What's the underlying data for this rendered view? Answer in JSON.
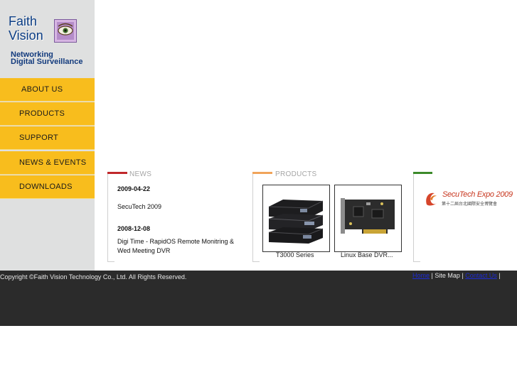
{
  "brand": {
    "logo_text_1": "Faith",
    "logo_text_2": "Vision",
    "tagline_1": "Networking",
    "tagline_2": "Digital Surveillance"
  },
  "nav": {
    "about": "ABOUT US",
    "products": "PRODUCTS",
    "support": "SUPPORT",
    "news": "NEWS & EVENTS",
    "downloads": "DOWNLOADS"
  },
  "news": {
    "title": "NEWS",
    "items": [
      {
        "date": "2009-04-22",
        "text": "SecuTech 2009"
      },
      {
        "date": "2008-12-08",
        "text": "Digi Time - RapidOS Remote Monitring & Wed Meeting DVR"
      }
    ]
  },
  "products": {
    "title": "PRODUCTS",
    "items": [
      {
        "caption": "T3000 Series"
      },
      {
        "caption": "Linux Base DVR..."
      }
    ]
  },
  "expo": {
    "logo_text": "SecuTech Expo 2009",
    "logo_subtext": "第十二屆台北國際安全博覽會"
  },
  "footer": {
    "copyright": "Copyright ©Faith Vision Technology Co., Ltd. All Rights Reserved.",
    "link_home": "Home",
    "link_sitemap": "Site Map",
    "link_contact": "Contact Us",
    "separator": "|"
  },
  "colors": {
    "nav_bg": "#f8bd1d",
    "sidebar_bg": "#dfe0e0",
    "news_accent": "#c0282b",
    "products_accent": "#f0a45a",
    "expo_accent": "#3c8a2a",
    "footer_bg": "#2b2b2b",
    "brand_blue": "#0b3d84"
  }
}
